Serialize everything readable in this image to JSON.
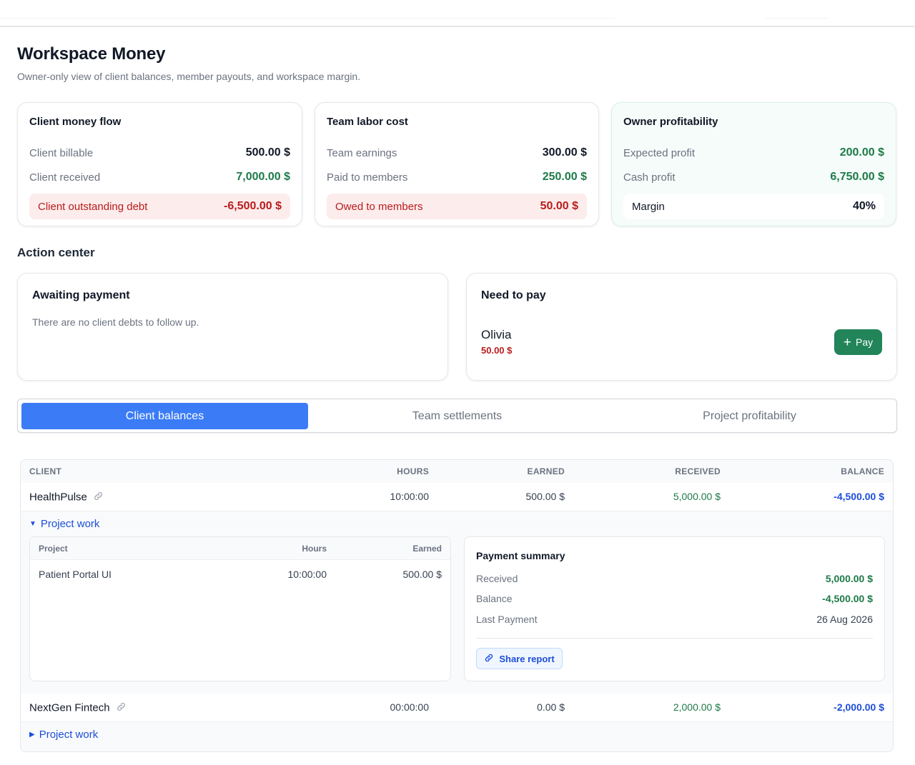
{
  "header": {
    "title": "Workspace Money",
    "subtitle": "Owner-only view of client balances, member payouts, and workspace margin."
  },
  "summary": {
    "client_money_flow": {
      "title": "Client money flow",
      "billable_label": "Client billable",
      "billable_value": "500.00 $",
      "received_label": "Client received",
      "received_value": "7,000.00 $",
      "debt_label": "Client outstanding debt",
      "debt_value": "-6,500.00 $"
    },
    "team_labor_cost": {
      "title": "Team labor cost",
      "earnings_label": "Team earnings",
      "earnings_value": "300.00 $",
      "paid_label": "Paid to members",
      "paid_value": "250.00 $",
      "owed_label": "Owed to members",
      "owed_value": "50.00 $"
    },
    "owner_profitability": {
      "title": "Owner profitability",
      "expected_label": "Expected profit",
      "expected_value": "200.00 $",
      "cash_label": "Cash profit",
      "cash_value": "6,750.00 $",
      "margin_label": "Margin",
      "margin_value": "40%"
    }
  },
  "action_center": {
    "title": "Action center",
    "awaiting": {
      "title": "Awaiting payment",
      "empty_text": "There are no client debts to follow up."
    },
    "need_to_pay": {
      "title": "Need to pay",
      "payee_name": "Olivia",
      "payee_amount": "50.00 $",
      "pay_label": "Pay"
    }
  },
  "tabs": [
    {
      "label": "Client balances",
      "active": true
    },
    {
      "label": "Team settlements",
      "active": false
    },
    {
      "label": "Project profitability",
      "active": false
    }
  ],
  "table": {
    "columns": [
      "CLIENT",
      "HOURS",
      "EARNED",
      "RECEIVED",
      "BALANCE"
    ],
    "rows": [
      {
        "client": "HealthPulse",
        "hours": "10:00:00",
        "earned": "500.00 $",
        "received": "5,000.00 $",
        "balance": "-4,500.00 $",
        "toggle_label": "Project work",
        "expanded": true
      },
      {
        "client": "NextGen Fintech",
        "hours": "00:00:00",
        "earned": "0.00 $",
        "received": "2,000.00 $",
        "balance": "-2,000.00 $",
        "toggle_label": "Project work",
        "expanded": false
      }
    ],
    "project_detail": {
      "columns": [
        "Project",
        "Hours",
        "Earned"
      ],
      "rows": [
        {
          "project": "Patient Portal UI",
          "hours": "10:00:00",
          "earned": "500.00 $"
        }
      ]
    },
    "payment_summary": {
      "title": "Payment summary",
      "received_label": "Received",
      "received_value": "5,000.00 $",
      "balance_label": "Balance",
      "balance_value": "-4,500.00 $",
      "last_payment_label": "Last Payment",
      "last_payment_value": "26 Aug 2026",
      "share_label": "Share report"
    }
  },
  "colors": {
    "accent_blue": "#3b7cf6",
    "positive_green": "#1d7a48",
    "negative_red": "#b91c1c",
    "pay_button": "#22855a"
  }
}
